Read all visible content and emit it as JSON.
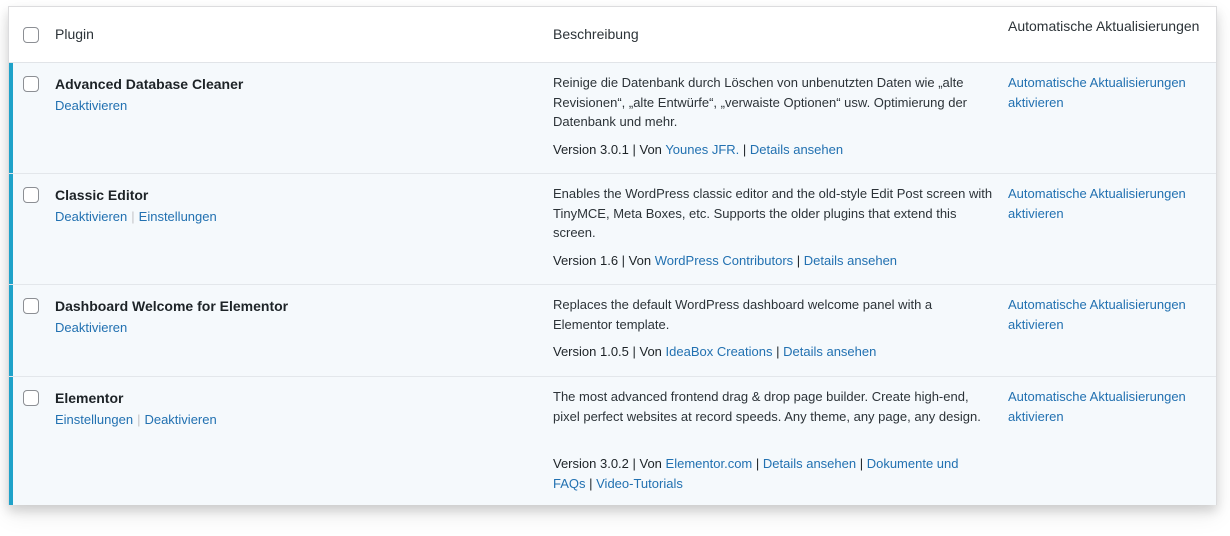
{
  "header": {
    "plugin": "Plugin",
    "description": "Beschreibung",
    "auto_updates": "Automatische Aktualisierungen"
  },
  "rows": [
    {
      "name": "Advanced Database Cleaner",
      "actions": [
        "Deaktivieren"
      ],
      "description": "Reinige die Datenbank durch Löschen von unbenutzten Daten wie „alte Revisionen“, „alte Entwürfe“, „verwaiste Optionen“ usw. Optimierung der Datenbank und mehr.",
      "version": "Version 3.0.1",
      "by": "Von",
      "author": "Younes JFR.",
      "links": [
        "Details ansehen"
      ],
      "auto_update": "Automatische Aktualisierungen aktivieren"
    },
    {
      "name": "Classic Editor",
      "actions": [
        "Deaktivieren",
        "Einstellungen"
      ],
      "description": "Enables the WordPress classic editor and the old-style Edit Post screen with TinyMCE, Meta Boxes, etc. Supports the older plugins that extend this screen.",
      "version": "Version 1.6",
      "by": "Von",
      "author": "WordPress Contributors",
      "links": [
        "Details ansehen"
      ],
      "auto_update": "Automatische Aktualisierungen aktivieren"
    },
    {
      "name": "Dashboard Welcome for Elementor",
      "actions": [
        "Deaktivieren"
      ],
      "description": "Replaces the default WordPress dashboard welcome panel with a Elementor template.",
      "version": "Version 1.0.5",
      "by": "Von",
      "author": "IdeaBox Creations",
      "links": [
        "Details ansehen"
      ],
      "auto_update": "Automatische Aktualisierungen aktivieren"
    },
    {
      "name": "Elementor",
      "actions": [
        "Einstellungen",
        "Deaktivieren"
      ],
      "description": "The most advanced frontend drag & drop page builder. Create high-end, pixel perfect websites at record speeds. Any theme, any page, any design.",
      "version": "Version 3.0.2",
      "by": "Von",
      "author": "Elementor.com",
      "links": [
        "Details ansehen",
        "Dokumente und FAQs",
        "Video-Tutorials"
      ],
      "auto_update": "Automatische Aktualisierungen aktivieren"
    }
  ]
}
